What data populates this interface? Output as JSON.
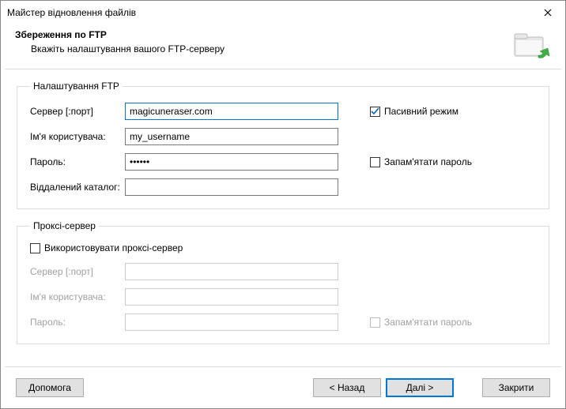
{
  "window": {
    "title": "Майстер відновлення файлів"
  },
  "header": {
    "title": "Збереження по FTP",
    "subtitle": "Вкажіть налаштування вашого FTP-серверу"
  },
  "ftp": {
    "legend": "Налаштування FTP",
    "server_label": "Сервер [:порт]",
    "server_value": "magicuneraser.com",
    "user_label": "Ім'я користувача:",
    "user_value": "my_username",
    "password_label": "Пароль:",
    "password_value": "••••••",
    "remote_label": "Віддалений каталог:",
    "remote_value": "",
    "passive_label": "Пасивний режим",
    "remember_label": "Запам'ятати пароль"
  },
  "proxy": {
    "legend": "Проксі-сервер",
    "use_proxy_label": "Використовувати проксі-сервер",
    "server_label": "Сервер [:порт]",
    "server_value": "",
    "user_label": "Ім'я користувача:",
    "user_value": "",
    "password_label": "Пароль:",
    "password_value": "",
    "remember_label": "Запам'ятати пароль"
  },
  "buttons": {
    "help": "Допомога",
    "back": "< Назад",
    "next": "Далі >",
    "close": "Закрити"
  }
}
